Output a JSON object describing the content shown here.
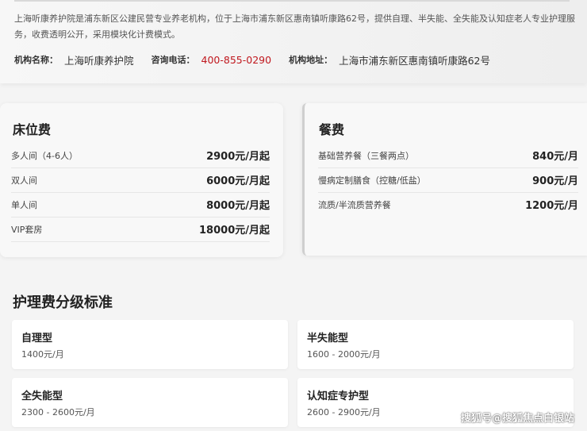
{
  "intro": {
    "description": "上海听康养护院是浦东新区公建民营专业养老机构，位于上海市浦东新区惠南镇听康路62号，提供自理、半失能、全失能及认知症老人专业护理服务，收费透明公开，采用模块化计费模式。",
    "name_label": "机构名称：",
    "name_value": "上海听康养护院",
    "phone_label": "咨询电话：",
    "phone_value": "400-855-0290",
    "address_label": "机构地址：",
    "address_value": "上海市浦东新区惠南镇听康路62号",
    "phone_color": "#c0181e"
  },
  "bed_fees": {
    "title": "床位费",
    "items": [
      {
        "name": "多人间（4-6人）",
        "price": "2900元/月起"
      },
      {
        "name": "双人间",
        "price": "6000元/月起"
      },
      {
        "name": "单人间",
        "price": "8000元/月起"
      },
      {
        "name": "VIP套房",
        "price": "18000元/月起"
      }
    ]
  },
  "meal_fees": {
    "title": "餐费",
    "items": [
      {
        "name": "基础营养餐（三餐两点）",
        "price": "840元/月"
      },
      {
        "name": "慢病定制膳食（控糖/低盐）",
        "price": "900元/月"
      },
      {
        "name": "流质/半流质营养餐",
        "price": "1200元/月"
      }
    ]
  },
  "care_levels": {
    "title": "护理费分级标准",
    "items": [
      {
        "name": "自理型",
        "price": "1400元/月"
      },
      {
        "name": "半失能型",
        "price": "1600 - 2000元/月"
      },
      {
        "name": "全失能型",
        "price": "2300 - 2600元/月"
      },
      {
        "name": "认知症专护型",
        "price": "2600 - 2900元/月"
      }
    ]
  },
  "watermark": "搜狐号@搜狐焦点白银站"
}
